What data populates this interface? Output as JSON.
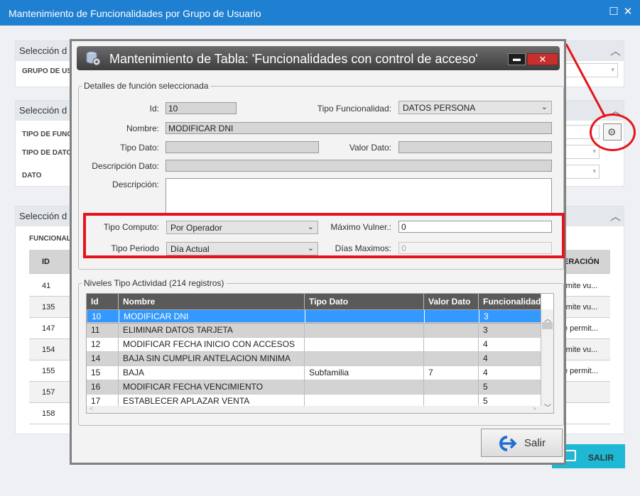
{
  "window": {
    "title": "Mantenimiento de Funcionalidades por Grupo de Usuario",
    "max_icon": "maximize-icon",
    "close_icon": "close-icon",
    "max_glyph": "☐",
    "close_glyph": "✕"
  },
  "background": {
    "panel1": {
      "title": "Selección d",
      "label": "GRUPO DE US"
    },
    "panel2": {
      "title": "Selección d",
      "labels": [
        "TIPO DE FUNC",
        "TIPO DE DATO",
        "DATO"
      ]
    },
    "panel3": {
      "title": "Selección d",
      "col_label": "FUNCIONAL",
      "header_id": "ID",
      "header_op": "ERACIÓN"
    },
    "rows": [
      {
        "id": "41",
        "op": "rmite vu..."
      },
      {
        "id": "135",
        "op": "rmite vu..."
      },
      {
        "id": "147",
        "op": "e permit..."
      },
      {
        "id": "154",
        "op": "rmite vu..."
      },
      {
        "id": "155",
        "op": "e permit..."
      },
      {
        "id": "157",
        "op": ""
      },
      {
        "id": "158",
        "op": ""
      }
    ],
    "salir_label": "SALIR",
    "chevron": "︿",
    "dropdown": "▾",
    "gear_glyph": "⚙",
    "accent": "#1f7fd0",
    "salir_color": "#1fb8d4",
    "annotation_color": "#e5141c"
  },
  "modal": {
    "title": "Mantenimiento de Tabla: 'Funcionalidades con control de acceso'",
    "max_glyph": "▬",
    "close_glyph": "✕",
    "details_legend": "Detalles de función seleccionada",
    "fields": {
      "id_label": "Id:",
      "id_value": "10",
      "tipo_func_label": "Tipo Funcionalidad:",
      "tipo_func_value": "DATOS PERSONA",
      "nombre_label": "Nombre:",
      "nombre_value": "MODIFICAR DNI",
      "tipo_dato_label": "Tipo Dato:",
      "tipo_dato_value": "",
      "valor_dato_label": "Valor Dato:",
      "valor_dato_value": "",
      "desc_dato_label": "Descripción Dato:",
      "desc_dato_value": "",
      "desc_label": "Descripción:",
      "desc_value": "",
      "tipo_computo_label": "Tipo Computo:",
      "tipo_computo_value": "Por Operador",
      "maximo_label": "Máximo Vulner.:",
      "maximo_value": "0",
      "tipo_periodo_label": "Tipo Periodo",
      "tipo_periodo_value": "Día Actual",
      "dias_label": "Días Maximos:",
      "dias_value": "0"
    },
    "grid_legend": "Niveles Tipo Actividad (214 registros)",
    "columns": [
      "Id",
      "Nombre",
      "Tipo Dato",
      "Valor Dato",
      "Funcionalidad"
    ],
    "rows": [
      {
        "id": "10",
        "nombre": "MODIFICAR DNI",
        "tipo": "",
        "valor": "",
        "func": "3"
      },
      {
        "id": "11",
        "nombre": "ELIMINAR DATOS TARJETA",
        "tipo": "",
        "valor": "",
        "func": "3"
      },
      {
        "id": "12",
        "nombre": "MODIFICAR FECHA INICIO CON ACCESOS",
        "tipo": "",
        "valor": "",
        "func": "4"
      },
      {
        "id": "14",
        "nombre": "BAJA SIN CUMPLIR ANTELACION MINIMA",
        "tipo": "",
        "valor": "",
        "func": "4"
      },
      {
        "id": "15",
        "nombre": "BAJA",
        "tipo": "Subfamilia",
        "valor": "7",
        "func": "4"
      },
      {
        "id": "16",
        "nombre": "MODIFICAR FECHA VENCIMIENTO",
        "tipo": "",
        "valor": "",
        "func": "5"
      },
      {
        "id": "17",
        "nombre": "ESTABLECER APLAZAR VENTA",
        "tipo": "",
        "valor": "",
        "func": "5"
      }
    ],
    "salir_label": "Salir",
    "salir_icon": "exit-icon",
    "dropdown_glyph": "⌄",
    "scroll_up": "︿",
    "scroll_down": "﹀",
    "scroll_left": "<",
    "scroll_right": ">",
    "selected_row_color": "#3399ff",
    "highlight_color": "#e5141c"
  }
}
